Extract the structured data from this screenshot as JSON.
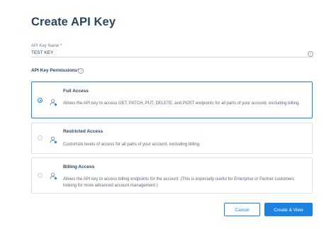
{
  "page": {
    "title": "Create API Key"
  },
  "api_key_name": {
    "label": "API Key Name",
    "required_mark": "*",
    "value": "TEST KEY",
    "info_icon": "info-icon"
  },
  "permissions": {
    "label": "API Key Permissions",
    "required_mark": "*",
    "info_icon": "info-icon",
    "selected": "full_access",
    "options": [
      {
        "id": "full_access",
        "icon": "user-key-icon",
        "title": "Full Access",
        "description": "Allows the API key to access GET, PATCH, PUT, DELETE, and POST endpoints for all parts of your account, excluding billing."
      },
      {
        "id": "restricted_access",
        "icon": "user-key-icon",
        "title": "Restricted Access",
        "description": "Customize levels of access for all parts of your account, excluding billing."
      },
      {
        "id": "billing_access",
        "icon": "user-key-icon",
        "title": "Billing Access",
        "description": "Allows the API key to access billing endpoints for the account. (This is especially useful for Enterprise or Partner customers looking for more advanced account management.)"
      }
    ]
  },
  "actions": {
    "cancel_label": "Cancel",
    "create_label": "Create & View"
  },
  "colors": {
    "accent": "#1a82e2",
    "text": "#294661",
    "required": "#d9534f"
  }
}
